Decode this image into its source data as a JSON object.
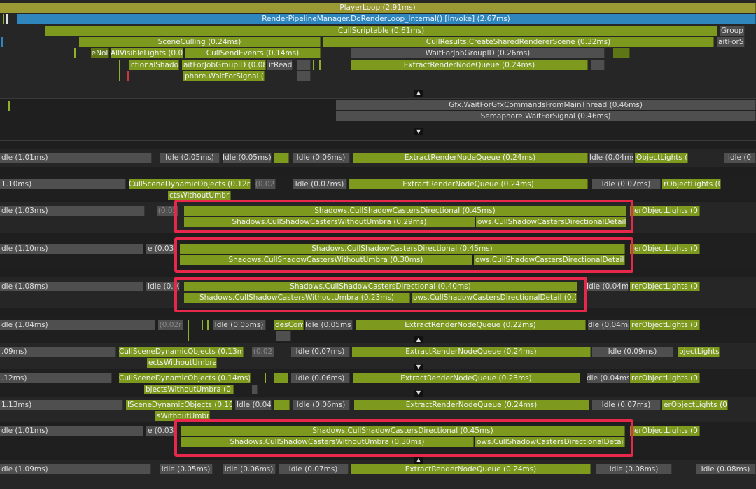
{
  "main_thread": {
    "player_loop": "PlayerLoop (2.91ms)",
    "render_loop": "RenderPipelineManager.DoRenderLoop_Internal() [Invoke] (2.67ms)",
    "cull_scriptable": "CullScriptable (0.61ms)",
    "group_label": "GroupI",
    "scene_culling": "SceneCulling (0.24ms)",
    "cull_results": "CullResults.CreateSharedRendererScene (0.32ms)",
    "wait_label": "aitForS",
    "nol_label": "eNol",
    "all_visible_lights": "AllVisibleLights (0.07r",
    "cull_send_events": "CullSendEvents (0.14ms)",
    "wait_job_group": "WaitForJobGroupID (0.26ms)",
    "directional_shadow": "ctionalShadow",
    "wait_job_group_small": "aitForJobGroupID (0.08n",
    "job_ready": "itReady",
    "extract_main": "ExtractRenderNodeQueue (0.24ms)",
    "semaphore_small": "phore.WaitForSignal (0.:",
    "expand_glyph": "▲"
  },
  "render_thread": {
    "gfx_wait": "Gfx.WaitForGfxCommandsFromMainThread (0.46ms)",
    "semaphore": "Semaphore.WaitForSignal (0.46ms)",
    "collapse_glyph": "▼"
  },
  "worker_rows": [
    {
      "labels": [
        "dle (1.01ms)",
        "Idle (0.05ms)",
        "Idle (0.05ms)",
        "Idle (0.06ms)",
        "ExtractRenderNodeQueue (0.24ms)",
        "Idle (0.04ms)",
        "ObjectLights (0",
        "Idle (0"
      ]
    },
    {
      "labels": [
        "1.10ms)",
        "CullSceneDynamicObjects (0.12ms)",
        "(0.02",
        "Idle (0.07ms)",
        "ExtractRenderNodeQueue (0.24ms)",
        "Idle (0.07ms)",
        "rObjectLights (0.",
        "ctsWithoutUmbra"
      ]
    },
    {
      "labels": [
        "dle (1.03ms)",
        "(0.02",
        "Shadows.CullShadowCastersDirectional (0.45ms)",
        "rerObjectLights (0.0",
        "Shadows.CullShadowCastersWithoutUmbra (0.29ms)",
        "ows.CullShadowCastersDirectionalDetail (0.1"
      ]
    },
    {
      "labels": [
        "dle (1.10ms)",
        "e (0.03r",
        "Shadows.CullShadowCastersDirectional (0.45ms)",
        "rerObjectLights (0.0",
        "Shadows.CullShadowCastersWithoutUmbra (0.30ms)",
        "ows.CullShadowCastersDirectionalDetail (0.1"
      ]
    },
    {
      "labels": [
        "dle (1.08ms)",
        "Idle (0.03r",
        "Shadows.CullShadowCastersDirectional (0.40ms)",
        "Idle (0.04ms)",
        "rerObjectLights (0.0",
        "Shadows.CullShadowCastersWithoutUmbra (0.23ms)",
        "ows.CullShadowCastersDirectionalDetail (0.17r"
      ]
    },
    {
      "labels": [
        "dle (1.04ms)",
        "(0.02r",
        "Idle (0.05ms)",
        "desCom",
        "Idle (0.05ms)",
        "ExtractRenderNodeQueue (0.22ms)",
        "dle (0.04ms",
        "rerObjectLights (0.0"
      ]
    },
    {
      "labels": [
        ".09ms)",
        "CullSceneDynamicObjects (0.13ms)",
        "(0.02",
        "Idle (0.07ms)",
        "ExtractRenderNodeQueue (0.24ms)",
        "Idle (0.09ms)",
        "bjectLights",
        "ectsWithoutUmbra (("
      ]
    },
    {
      "labels": [
        ".12ms)",
        "CullSceneDynamicObjects (0.14ms)",
        "Idle (0.06ms)",
        "ExtractRenderNodeQueue (0.23ms)",
        "dle (0.04ms",
        "rerObjectLights (0.0",
        "bjectsWithoutUmbra (0.0"
      ]
    },
    {
      "labels": [
        "1.13ms)",
        "lSceneDynamicObjects (0.10r",
        "Idle (0.04m",
        "Idle (0.06ms)",
        "ExtractRenderNodeQueue (0.24ms)",
        "Idle (0.07ms)",
        "erObjectLights (0.(",
        "sWithoutUmbra"
      ]
    },
    {
      "labels": [
        "dle (1.01ms)",
        "e (0.03r",
        "Shadows.CullShadowCastersDirectional (0.45ms)",
        "rerObjectLights (0.0",
        "Shadows.CullShadowCastersWithoutUmbra (0.30ms)",
        "ows.CullShadowCastersDirectionalDetail (0.1"
      ]
    },
    {
      "labels": [
        "dle (1.09ms)",
        "Idle (0.05ms)",
        "Idle (0.06ms)",
        "Idle (0.07ms)",
        "ExtractRenderNodeQueue (0.24ms)",
        "Idle (0.08ms)",
        "Idle (0.08ms)"
      ]
    }
  ],
  "colors": {
    "highlight": "#e8284a",
    "green": "#7e9a1e",
    "idle": "#4f4f4f",
    "blue": "#2f86bd"
  }
}
